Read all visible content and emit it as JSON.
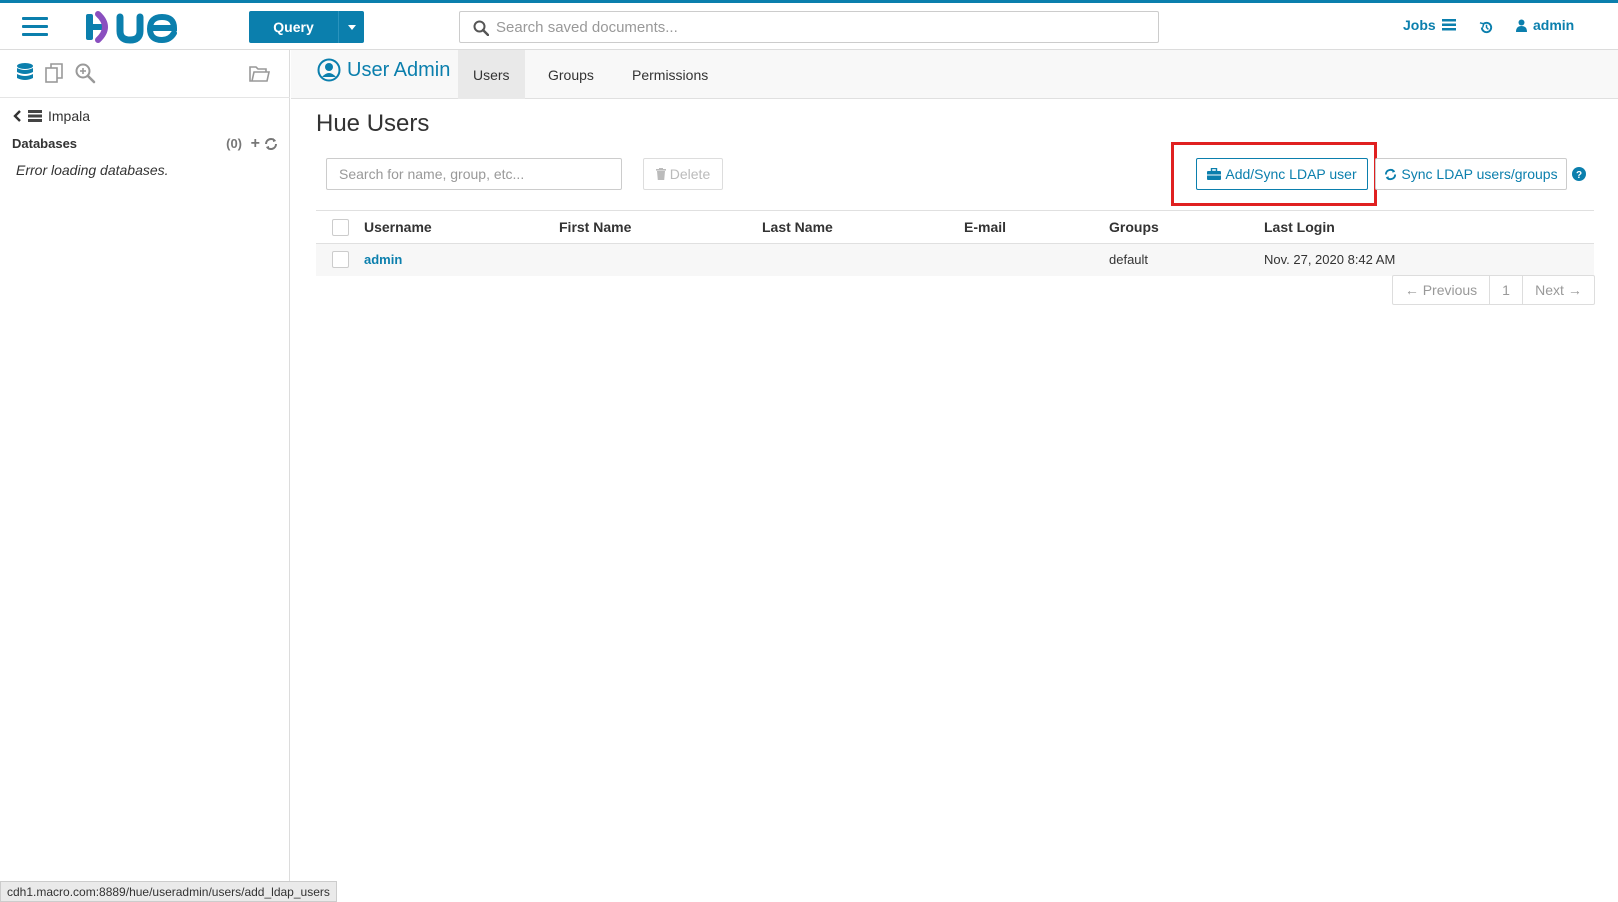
{
  "topbar": {
    "query_label": "Query",
    "search_placeholder": "Search saved documents...",
    "jobs_label": "Jobs",
    "user_label": "admin"
  },
  "sidebar": {
    "crumb": "Impala",
    "databases_label": "Databases",
    "databases_count": "(0)",
    "error_text": "Error loading databases."
  },
  "subnav": {
    "app_title": "User Admin",
    "tabs": [
      {
        "label": "Users",
        "active": true
      },
      {
        "label": "Groups",
        "active": false
      },
      {
        "label": "Permissions",
        "active": false
      }
    ]
  },
  "main": {
    "page_title": "Hue Users",
    "filter_placeholder": "Search for name, group, etc...",
    "delete_label": "Delete",
    "add_ldap_label": "Add/Sync LDAP user",
    "sync_ldap_label": "Sync LDAP users/groups",
    "columns": [
      "Username",
      "First Name",
      "Last Name",
      "E-mail",
      "Groups",
      "Last Login"
    ],
    "rows": [
      {
        "username": "admin",
        "first_name": "",
        "last_name": "",
        "email": "",
        "groups": "default",
        "last_login": "Nov. 27, 2020 8:42 AM"
      }
    ],
    "pager": {
      "prev": "← Previous",
      "page": "1",
      "next": "Next →"
    }
  },
  "status_url": "cdh1.macro.com:8889/hue/useradmin/users/add_ldap_users",
  "colors": {
    "accent": "#0b7fad",
    "highlight": "#e02020"
  }
}
